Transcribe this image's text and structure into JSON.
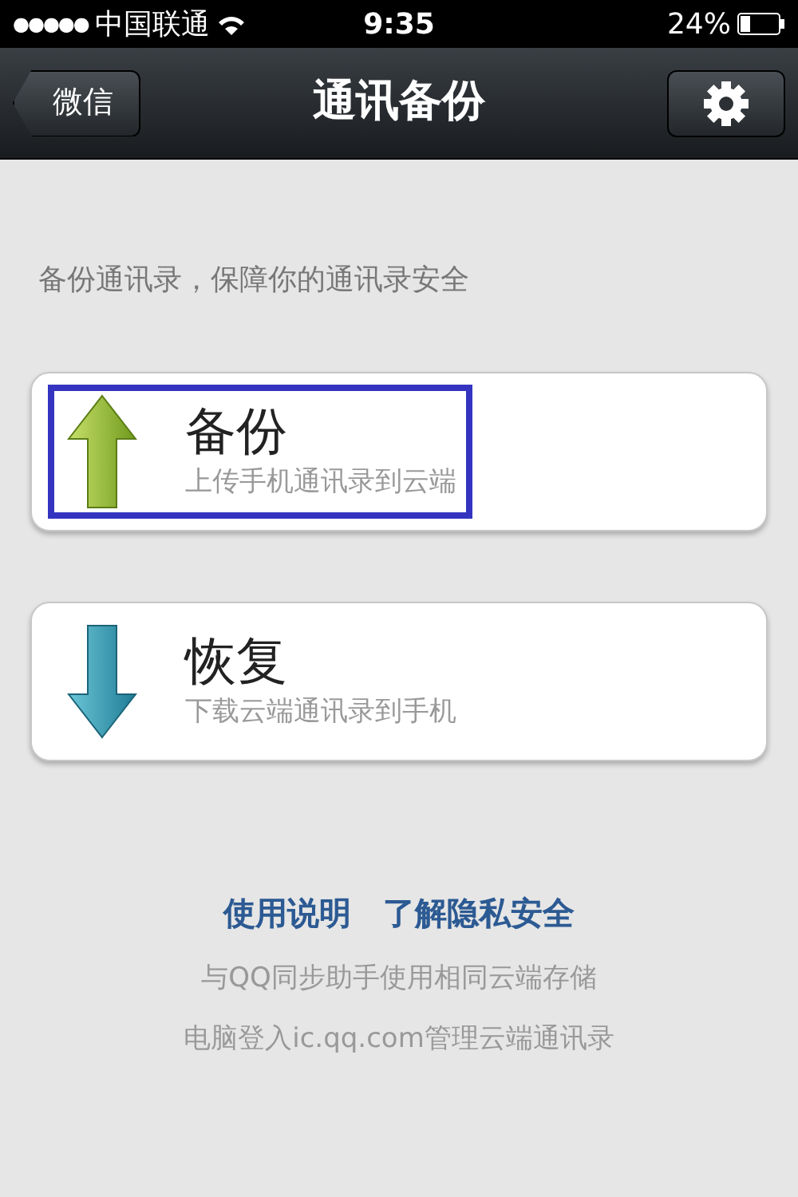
{
  "status_bar": {
    "signal": "●●●●●",
    "carrier": "中国联通",
    "time": "9:35",
    "battery": "24%"
  },
  "nav_bar": {
    "back": "微信",
    "title": "通讯备份"
  },
  "intro": "备份通讯录，保障你的通讯录安全",
  "actions": [
    {
      "kind": "upload",
      "title": "备份",
      "subtitle": "上传手机通讯录到云端",
      "highlighted": true
    },
    {
      "kind": "download",
      "title": "恢复",
      "subtitle": "下载云端通讯录到手机",
      "highlighted": false
    }
  ],
  "links": [
    "使用说明",
    "了解隐私安全"
  ],
  "notes": [
    "与QQ同步助手使用相同云端存储",
    "电脑登入ic.qq.com管理云端通讯录"
  ]
}
